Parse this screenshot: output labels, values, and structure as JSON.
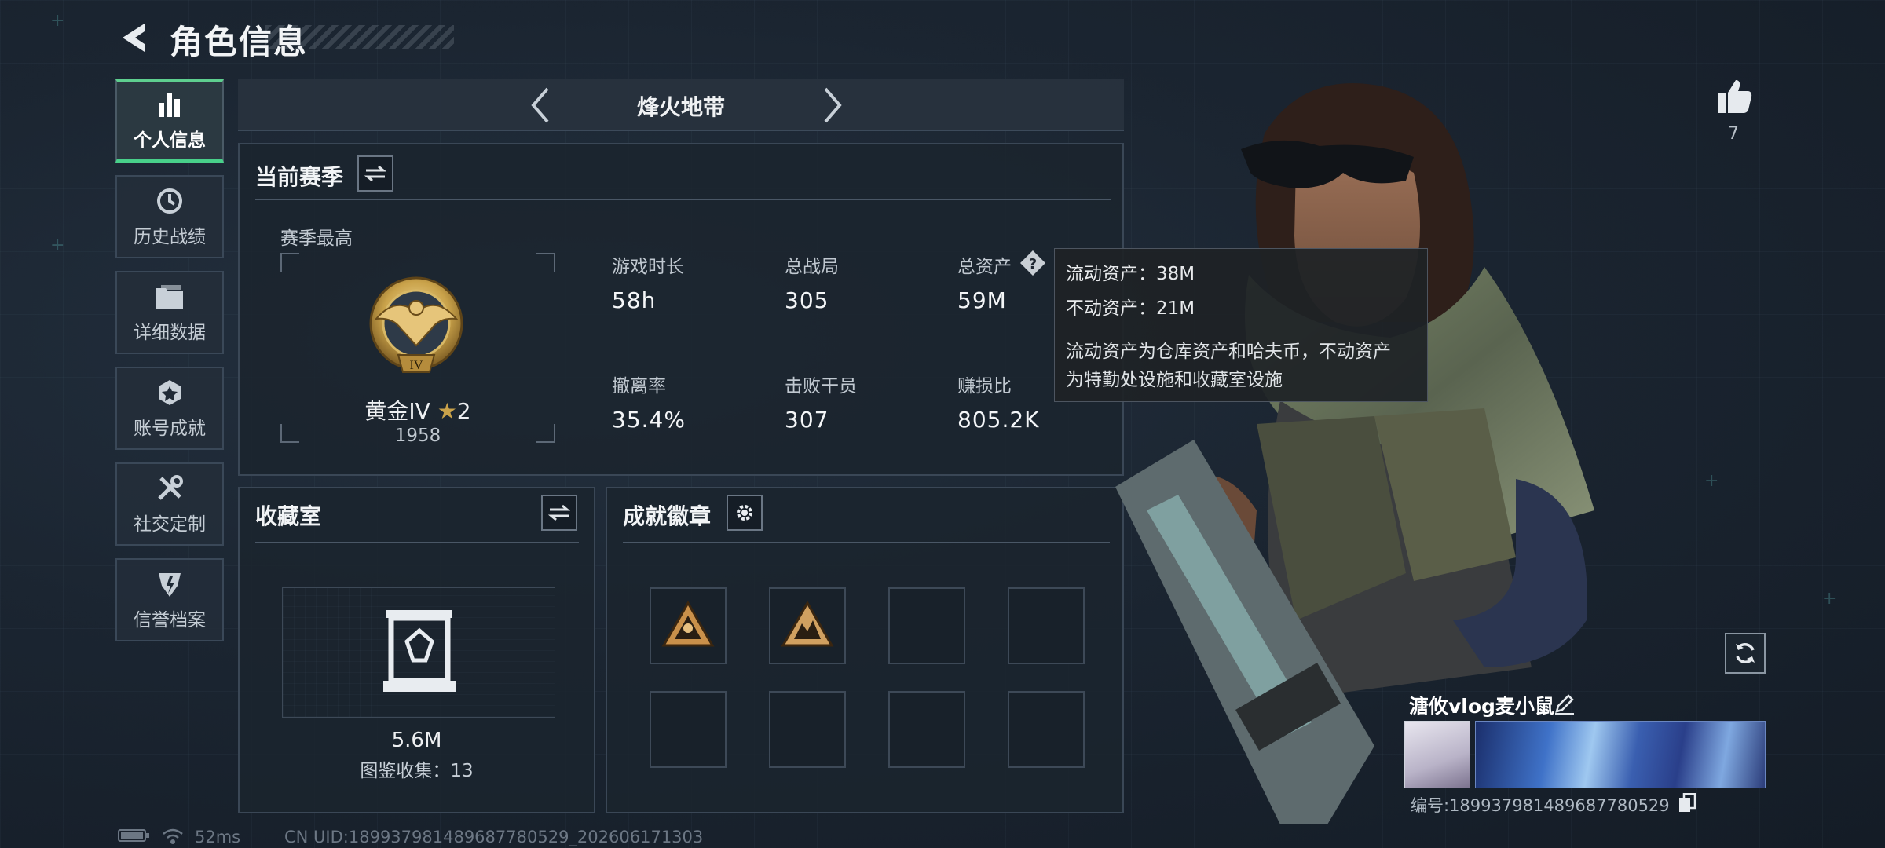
{
  "header": {
    "title": "角色信息"
  },
  "nav": {
    "items": [
      {
        "label": "个人信息",
        "icon": "bar-chart-icon",
        "active": true
      },
      {
        "label": "历史战绩",
        "icon": "history-clock-icon",
        "active": false
      },
      {
        "label": "详细数据",
        "icon": "folder-icon",
        "active": false
      },
      {
        "label": "账号成就",
        "icon": "achievement-icon",
        "active": false
      },
      {
        "label": "社交定制",
        "icon": "tools-icon",
        "active": false
      },
      {
        "label": "信誉档案",
        "icon": "credit-shield-icon",
        "active": false
      }
    ]
  },
  "mode": {
    "title": "烽火地带"
  },
  "season": {
    "title": "当前赛季",
    "best_label": "赛季最高",
    "rank": "黄金IV",
    "rank_numeral": "IV",
    "stars": "2",
    "rating": "1958",
    "stats": [
      {
        "label": "游戏时长",
        "value": "58h"
      },
      {
        "label": "总战局",
        "value": "305"
      },
      {
        "label": "总资产",
        "value": "59M"
      },
      {
        "label": "撤离率",
        "value": "35.4%"
      },
      {
        "label": "击败干员",
        "value": "307"
      },
      {
        "label": "赚损比",
        "value": "805.2K"
      }
    ]
  },
  "tooltip": {
    "liquid": "流动资产：38M",
    "fixed": "不动资产：21M",
    "desc_line1": "流动资产为仓库资产和哈夫币，不动资产",
    "desc_line2": "为特勤处设施和收藏室设施"
  },
  "collection": {
    "title": "收藏室",
    "value": "5.6M",
    "count": "图鉴收集：13"
  },
  "badges": {
    "title": "成就徽章",
    "slots": [
      {
        "filled": true
      },
      {
        "filled": true
      },
      {
        "filled": false
      },
      {
        "filled": false
      },
      {
        "filled": false
      },
      {
        "filled": false
      },
      {
        "filled": false
      },
      {
        "filled": false
      }
    ]
  },
  "player": {
    "likes": "7",
    "name": "溏攸vlog麦小鼠",
    "id": "编号:18993798148968778052​9"
  },
  "status": {
    "ping": "52ms",
    "uid": "CN UID:1899379814896877805​29_202606171303"
  },
  "colors": {
    "accent": "#48d08a",
    "gold": "#c9a24a"
  }
}
